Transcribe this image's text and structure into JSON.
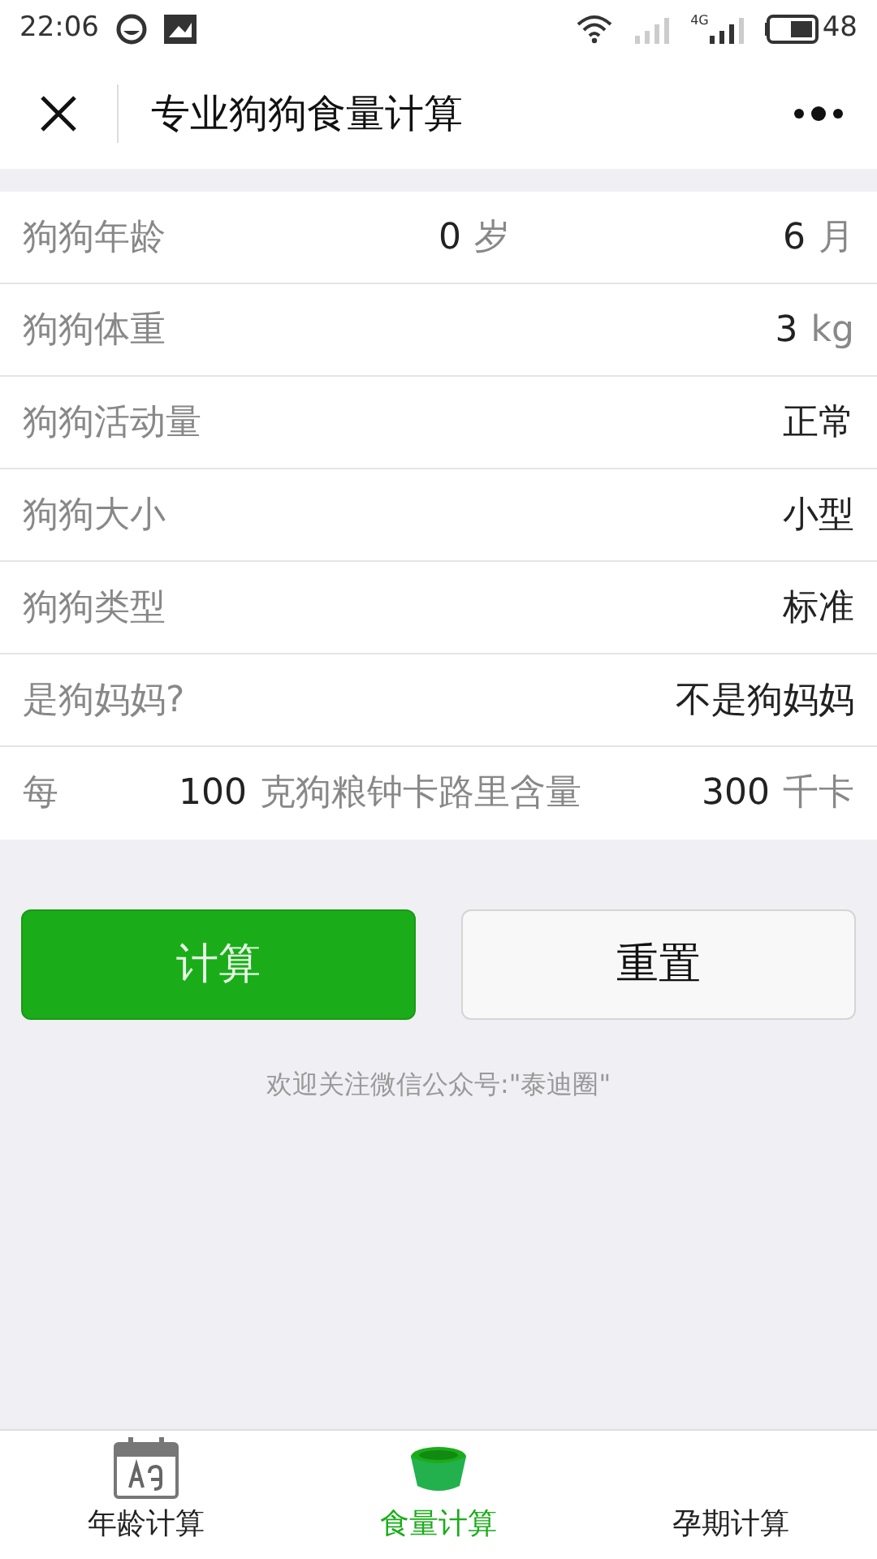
{
  "status_bar": {
    "time": "22:06",
    "network": "4G",
    "battery": "48"
  },
  "header": {
    "title": "专业狗狗食量计算"
  },
  "rows": [
    {
      "label": "狗狗年龄",
      "fields": [
        {
          "value": "0",
          "unit": "岁"
        },
        {
          "value": "6",
          "unit": "月"
        }
      ]
    },
    {
      "label": "狗狗体重",
      "fields": [
        {
          "value": "3",
          "unit": "kg"
        }
      ]
    },
    {
      "label": "狗狗活动量",
      "fields": [
        {
          "value": "正常"
        }
      ]
    },
    {
      "label": "狗狗大小",
      "fields": [
        {
          "value": "小型"
        }
      ]
    },
    {
      "label": "狗狗类型",
      "fields": [
        {
          "value": "标准"
        }
      ]
    },
    {
      "label": "是狗妈妈?",
      "fields": [
        {
          "value": "不是狗妈妈"
        }
      ]
    },
    {
      "label": "每",
      "fields": [
        {
          "value": "100",
          "unit": "克狗粮钟卡路里含量"
        },
        {
          "value": "300",
          "unit": "千卡"
        }
      ]
    }
  ],
  "buttons": [
    {
      "label": "计算",
      "kind": "primary"
    },
    {
      "label": "重置",
      "kind": "default"
    }
  ],
  "footer_note": "欢迎关注微信公众号:\"泰迪圈\"",
  "tabs": [
    {
      "label": "年龄计算",
      "selected": false,
      "kind": "calendar"
    },
    {
      "label": "食量计算",
      "selected": true,
      "kind": "bowl"
    },
    {
      "label": "孕期计算",
      "selected": false,
      "kind": "none"
    }
  ]
}
